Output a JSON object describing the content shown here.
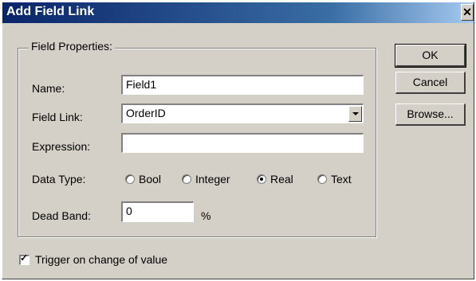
{
  "window": {
    "title": "Add Field Link",
    "close_glyph": "✕"
  },
  "group": {
    "title": "Field Properties:"
  },
  "name": {
    "label": "Name:",
    "value": "Field1"
  },
  "field_link": {
    "label": "Field Link:",
    "value": "OrderID"
  },
  "expression": {
    "label": "Expression:",
    "value": ""
  },
  "data_type": {
    "label": "Data Type:",
    "options": [
      "Bool",
      "Integer",
      "Real",
      "Text"
    ],
    "selected": "Real"
  },
  "dead_band": {
    "label": "Dead Band:",
    "value": "0",
    "unit": "%"
  },
  "buttons": {
    "ok": "OK",
    "cancel": "Cancel",
    "browse": "Browse..."
  },
  "trigger": {
    "label": "Trigger on change of value",
    "checked": true
  }
}
